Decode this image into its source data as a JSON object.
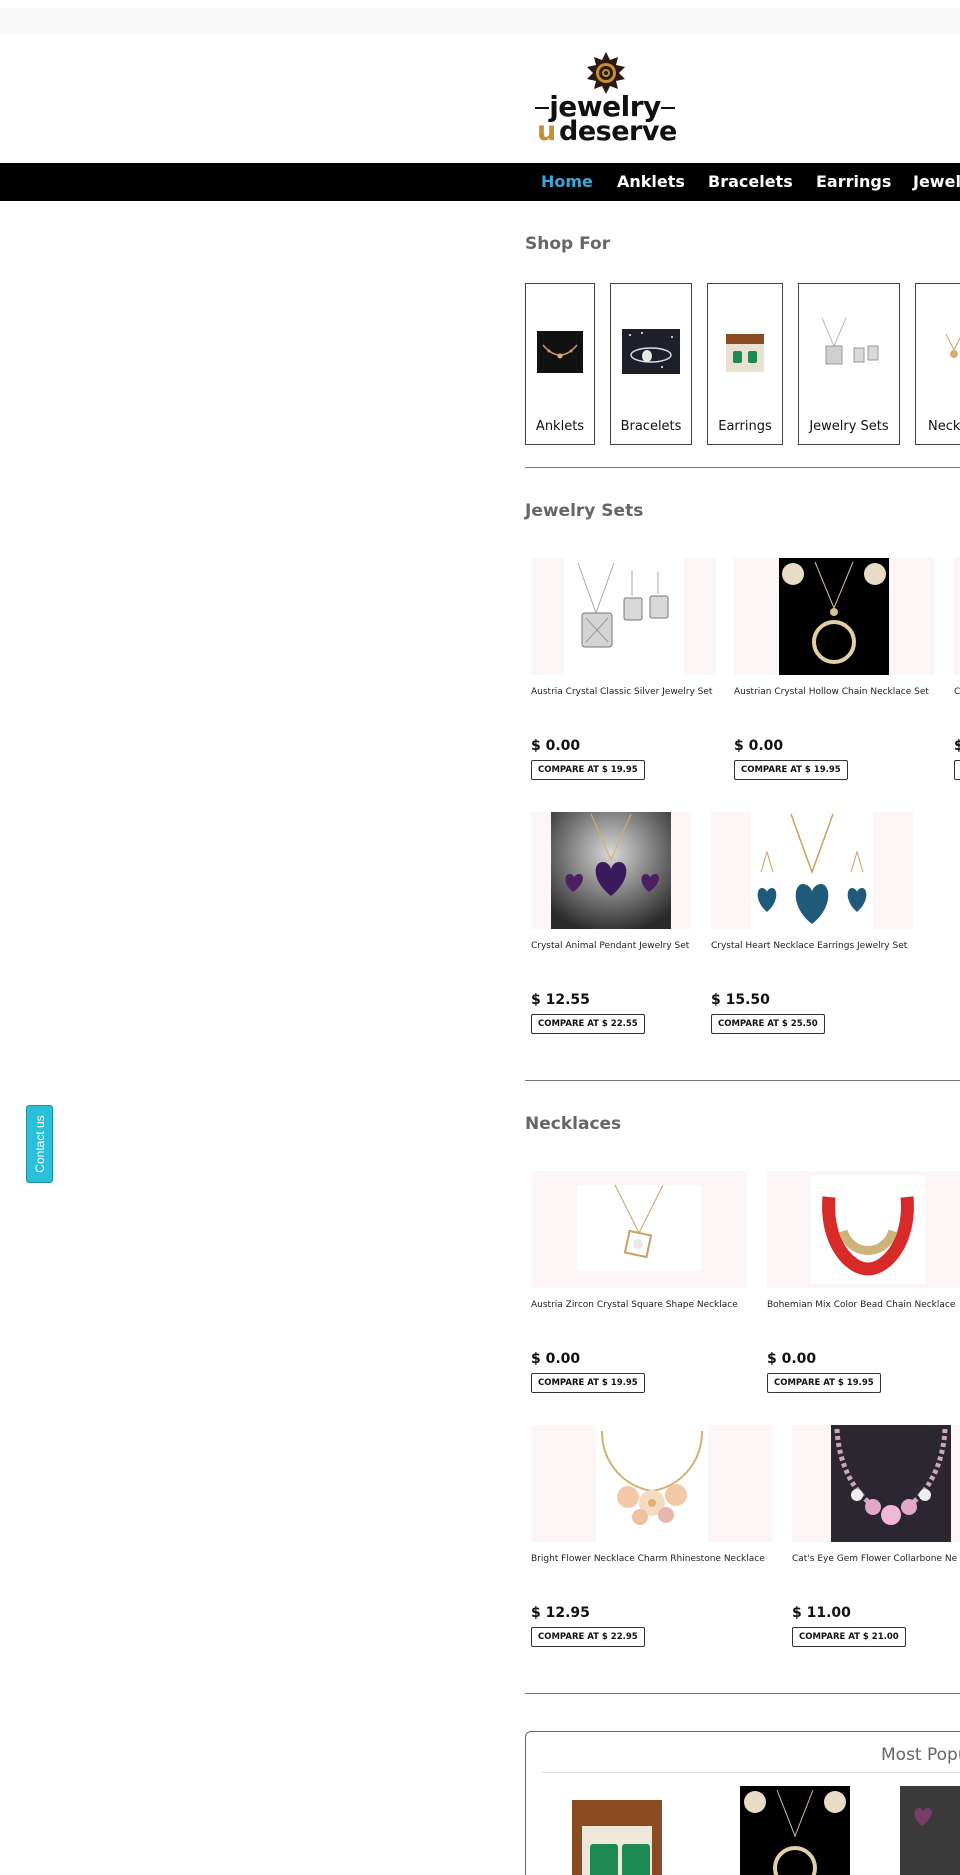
{
  "brand": {
    "line1": "jewelry",
    "line2_u": "u",
    "line2_rest": "deserve",
    "colors": {
      "accent_gold": "#c49034",
      "ink": "#111111"
    }
  },
  "nav": {
    "items": [
      {
        "label": "Home",
        "active": true
      },
      {
        "label": "Anklets"
      },
      {
        "label": "Bracelets"
      },
      {
        "label": "Earrings"
      },
      {
        "label": "Jewel"
      }
    ],
    "colors": {
      "bar": "#000000",
      "active": "#3aa6d8"
    }
  },
  "contact_tab": {
    "label": "Contact us",
    "color": "#2bc0d9"
  },
  "shop_for": {
    "title": "Shop For",
    "cards": [
      {
        "label": "Anklets"
      },
      {
        "label": "Bracelets"
      },
      {
        "label": "Earrings"
      },
      {
        "label": "Jewelry Sets"
      },
      {
        "label": "Neckl"
      }
    ]
  },
  "jewelry_sets": {
    "title": "Jewelry Sets",
    "products": [
      {
        "name": "Austria Crystal Classic Silver Jewelry Set",
        "price": "$ 0.00",
        "compare": "COMPARE AT $ 19.95"
      },
      {
        "name": "Austrian Crystal Hollow Chain Necklace Set",
        "price": "$ 0.00",
        "compare": "COMPARE AT $ 19.95"
      },
      {
        "name": "C",
        "price": "$",
        "compare": ""
      },
      {
        "name": "Crystal Animal Pendant Jewelry Set",
        "price": "$ 12.55",
        "compare": "COMPARE AT $ 22.55"
      },
      {
        "name": "Crystal Heart Necklace Earrings Jewelry Set",
        "price": "$ 15.50",
        "compare": "COMPARE AT $ 25.50"
      }
    ]
  },
  "necklaces": {
    "title": "Necklaces",
    "products": [
      {
        "name": "Austria Zircon Crystal Square Shape Necklace",
        "price": "$ 0.00",
        "compare": "COMPARE AT $ 19.95"
      },
      {
        "name": "Bohemian Mix Color Bead Chain Necklace",
        "price": "$ 0.00",
        "compare": "COMPARE AT $ 19.95"
      },
      {
        "name": "Bright Flower Necklace Charm Rhinestone Necklace",
        "price": "$ 12.95",
        "compare": "COMPARE AT $ 22.95"
      },
      {
        "name": "Cat's Eye Gem Flower Collarbone Ne",
        "price": "$ 11.00",
        "compare": "COMPARE AT $ 21.00"
      }
    ]
  },
  "most_popular": {
    "title": "Most Popu"
  }
}
